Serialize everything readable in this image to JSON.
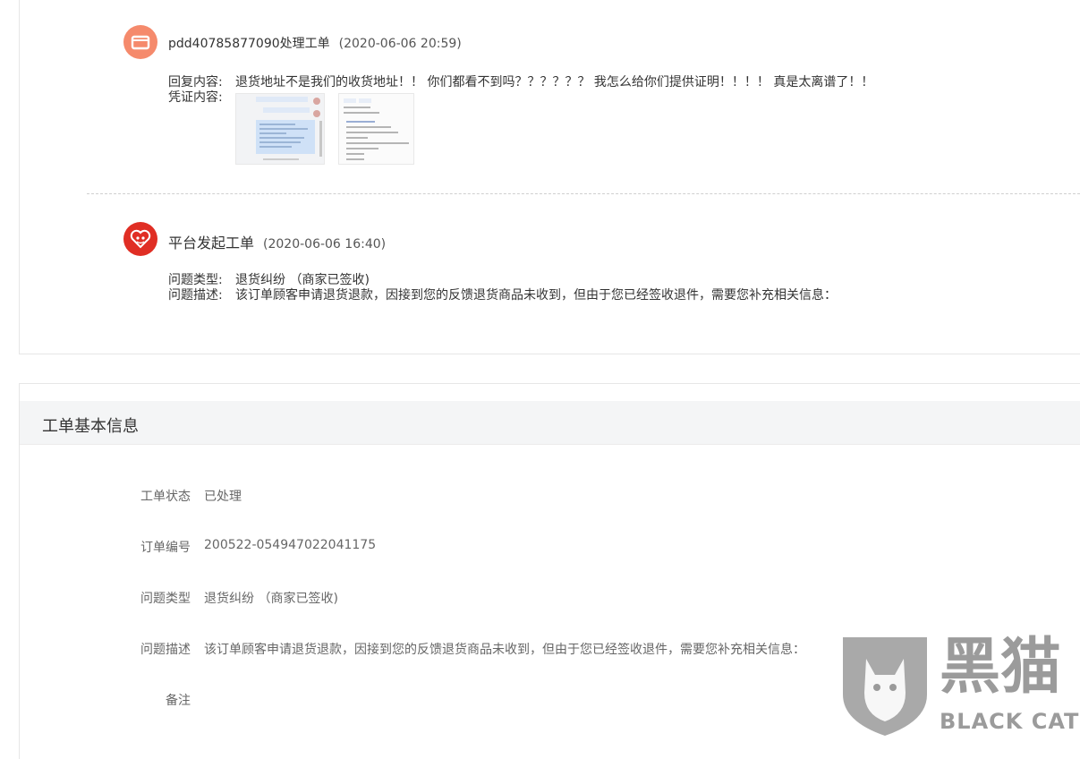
{
  "entries": [
    {
      "author": "pdd40785877090处理工单",
      "time": "(2020-06-06 20:59)",
      "reply_label": "回复内容:",
      "reply_text": "退货地址不是我们的收货地址！！ 你们都看不到吗？？？？？？ 我怎么给你们提供证明！！！！ 真是太离谱了！！",
      "evidence_label": "凭证内容:"
    },
    {
      "author": "平台发起工单",
      "time": "(2020-06-06 16:40)",
      "type_label": "问题类型:",
      "type_value": "退货纠纷 （商家已签收)",
      "desc_label": "问题描述:",
      "desc_value": "该订单顾客申请退货退款，因接到您的反馈退货商品未收到，但由于您已经签收退件，需要您补充相关信息："
    }
  ],
  "basic_info": {
    "title": "工单基本信息",
    "rows": [
      {
        "label": "工单状态",
        "value": "已处理"
      },
      {
        "label": "订单编号",
        "value": "200522-054947022041175"
      },
      {
        "label": "问题类型",
        "value": "退货纠纷 （商家已签收)"
      },
      {
        "label": "问题描述",
        "value": "该订单顾客申请退货退款，因接到您的反馈退货商品未收到，但由于您已经签收退件，需要您补充相关信息："
      },
      {
        "label": "备注",
        "value": ""
      }
    ]
  },
  "watermark": {
    "cn": "黑猫",
    "en": "BLACK CAT",
    "icon": "black-cat-shield-logo"
  },
  "colors": {
    "store_avatar": "#f58a6c",
    "platform_avatar": "#e02e24",
    "section_bg": "#f4f5f6"
  }
}
